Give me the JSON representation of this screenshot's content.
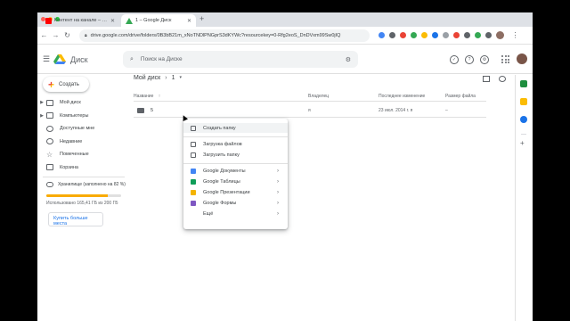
{
  "browser": {
    "tabs": [
      {
        "title": "Контент на канале – YouTube"
      },
      {
        "title": "1 – Google Диск"
      }
    ],
    "new_tab": "+",
    "url": "drive.google.com/drive/folders/0B3bB21m_xNoTNDlPNGprS3dKYWc?resourcekey=0-Rfg2eoS_DnDVxm99Sw0jIQ"
  },
  "drive": {
    "app_name": "Диск",
    "search_placeholder": "Поиск на Диске"
  },
  "sidebar": {
    "create_label": "Создать",
    "items": [
      {
        "label": "Мой диск",
        "icon": "my-drive-icon"
      },
      {
        "label": "Компьютеры",
        "icon": "computers-icon"
      },
      {
        "label": "Доступные мне",
        "icon": "shared-icon"
      },
      {
        "label": "Недавние",
        "icon": "recent-icon"
      },
      {
        "label": "Помеченные",
        "icon": "starred-icon"
      },
      {
        "label": "Корзина",
        "icon": "trash-icon"
      }
    ],
    "storage_label": "Хранилище (заполнено на 82 %)",
    "storage_percent": 82,
    "storage_used": "Использовано 165,41 ГБ из 200 ГБ",
    "buy_label": "Купить больше места"
  },
  "main": {
    "breadcrumb_root": "Мой диск",
    "breadcrumb_sep": "›",
    "breadcrumb_current": "1",
    "columns": {
      "name": "Название",
      "sort": "↑",
      "owner": "Владелец",
      "modified": "Последнее изменение",
      "size": "Размер файла"
    },
    "rows": [
      {
        "name": "5",
        "owner": "я",
        "modified": "23 июл. 2014 г. я",
        "size": "–"
      }
    ]
  },
  "context_menu": {
    "items": [
      {
        "label": "Создать папку",
        "icon": "new-folder-icon",
        "color": "#5f6368"
      },
      {
        "label": "Загрузка файлов",
        "icon": "file-upload-icon",
        "color": "#5f6368"
      },
      {
        "label": "Загрузить папку",
        "icon": "folder-upload-icon",
        "color": "#5f6368"
      },
      {
        "label": "Google Документы",
        "icon": "docs-icon",
        "color": "#4285f4"
      },
      {
        "label": "Google Таблицы",
        "icon": "sheets-icon",
        "color": "#0f9d58"
      },
      {
        "label": "Google Презентации",
        "icon": "slides-icon",
        "color": "#f4b400"
      },
      {
        "label": "Google Формы",
        "icon": "forms-icon",
        "color": "#7e57c2"
      },
      {
        "label": "Ещё",
        "icon": "more-icon",
        "color": "#5f6368"
      }
    ],
    "submenu_arrow": "›"
  }
}
